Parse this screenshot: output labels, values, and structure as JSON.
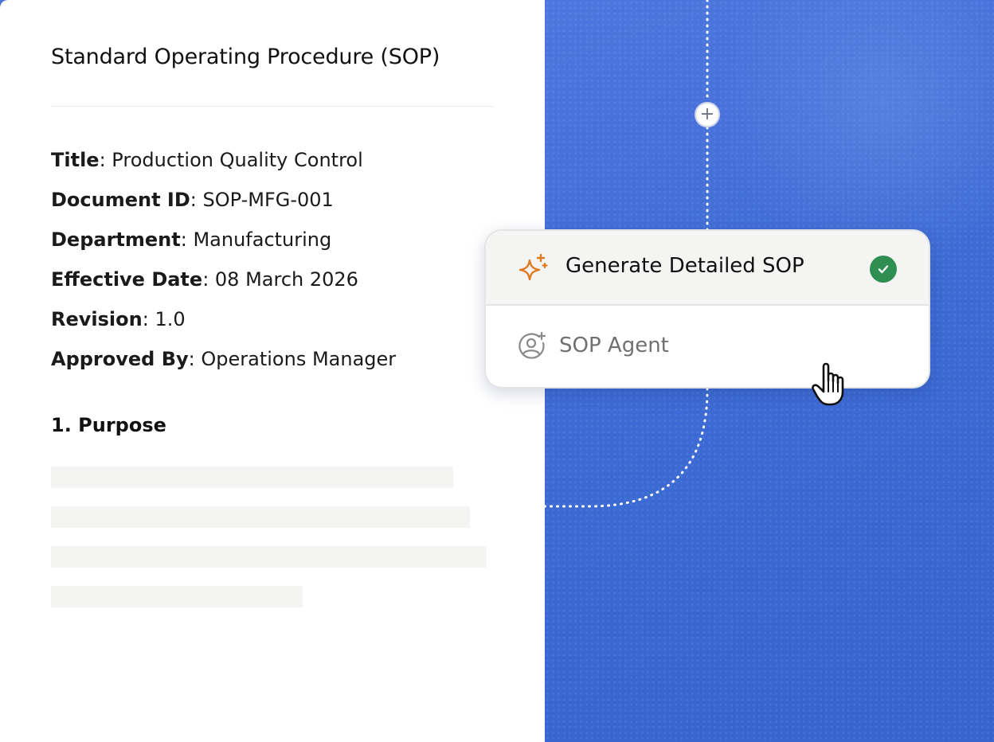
{
  "document": {
    "title": "Standard Operating Procedure (SOP)",
    "meta": [
      {
        "key": "Title",
        "value": "Production Quality Control"
      },
      {
        "key": "Document ID",
        "value": "SOP-MFG-001"
      },
      {
        "key": "Department",
        "value": "Manufacturing"
      },
      {
        "key": "Effective Date",
        "value": "08 March 2026"
      },
      {
        "key": "Revision",
        "value": "1.0"
      },
      {
        "key": "Approved By",
        "value": "Operations Manager"
      }
    ],
    "section_heading": "1. Purpose",
    "placeholder_lines": 4
  },
  "connector": {
    "plus_symbol": "+"
  },
  "action_card": {
    "primary": {
      "label": "Generate Detailed SOP",
      "icon": "sparkle-icon",
      "status_icon": "check-circle-icon",
      "status": "complete"
    },
    "secondary": {
      "label": "SOP Agent",
      "icon": "user-add-icon"
    }
  },
  "cursor": {
    "icon": "pointer-hand-icon"
  },
  "colors": {
    "background_blue": "#3e6bd4",
    "sparkle_orange": "#e07a1f",
    "check_green": "#2f8f52",
    "muted_text": "#707070"
  }
}
